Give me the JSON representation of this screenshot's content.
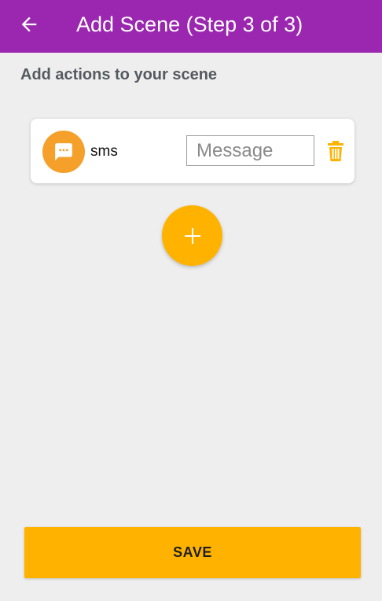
{
  "header": {
    "title": "Add Scene (Step 3 of 3)",
    "back_icon": "arrow-left-icon",
    "background_color": "#9b27b0"
  },
  "subtitle": "Add actions to your scene",
  "actions": [
    {
      "icon": "chat-bubble-icon",
      "icon_color": "#f5a02b",
      "name": "sms",
      "input_value": "",
      "input_placeholder": "Message",
      "delete_icon": "trash-icon"
    }
  ],
  "add_button": {
    "icon": "plus-icon",
    "color": "#ffb300"
  },
  "save_button": {
    "label": "SAVE",
    "color": "#ffb300"
  }
}
